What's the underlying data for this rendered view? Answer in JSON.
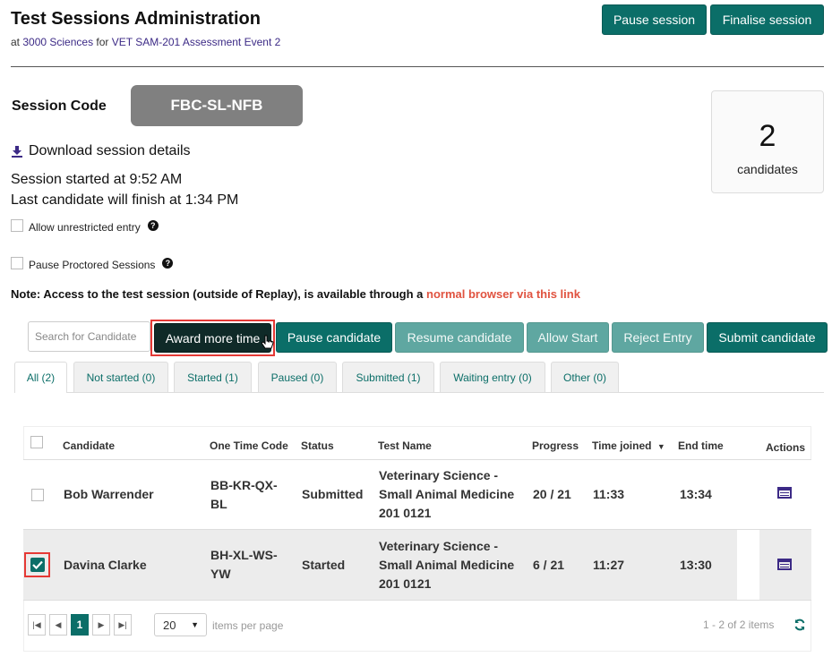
{
  "header": {
    "title": "Test Sessions Administration",
    "sub_prefix": "at ",
    "org_link": "3000 Sciences",
    "sub_for": " for ",
    "event_link": "VET SAM-201 Assessment Event 2",
    "pause_session": "Pause session",
    "finalise_session": "Finalise session"
  },
  "session": {
    "code_label": "Session Code",
    "code": "FBC-SL-NFB",
    "candidate_count": "2",
    "candidate_label": "candidates",
    "download": "Download session details",
    "started": "Session started at 9:52 AM",
    "last_finish": "Last candidate will finish at 1:34 PM",
    "allow_unrestricted": "Allow unrestricted entry",
    "pause_proctored": "Pause Proctored Sessions",
    "note_prefix": "Note: Access to the test session (outside of Replay), is available through a ",
    "note_link": "normal browser via this link"
  },
  "actions": {
    "search_placeholder": "Search for Candidate",
    "award_more_time": "Award more time",
    "pause_candidate": "Pause candidate",
    "resume_candidate": "Resume candidate",
    "allow_start": "Allow Start",
    "reject_entry": "Reject Entry",
    "submit_candidate": "Submit candidate"
  },
  "tabs": [
    {
      "label": "All (2)"
    },
    {
      "label": "Not started (0)"
    },
    {
      "label": "Started (1)"
    },
    {
      "label": "Paused (0)"
    },
    {
      "label": "Submitted (1)"
    },
    {
      "label": "Waiting entry (0)"
    },
    {
      "label": "Other (0)"
    }
  ],
  "table": {
    "columns": {
      "candidate": "Candidate",
      "code": "One Time Code",
      "status": "Status",
      "test": "Test Name",
      "progress": "Progress",
      "joined": "Time joined",
      "end": "End time",
      "actions": "Actions"
    },
    "rows": [
      {
        "name": "Bob Warrender",
        "code1": "BB-KR-QX-",
        "code2": "BL",
        "status": "Submitted",
        "test1": "Veterinary Science -",
        "test2": "Small Animal Medicine",
        "test3": "201 0121",
        "progress": "20 / 21",
        "joined": "11:33",
        "end": "13:34",
        "checked": false
      },
      {
        "name": "Davina Clarke",
        "code1": "BH-XL-WS-",
        "code2": "YW",
        "status": "Started",
        "test1": "Veterinary Science -",
        "test2": "Small Animal Medicine",
        "test3": "201 0121",
        "progress": "6 / 21",
        "joined": "11:27",
        "end": "13:30",
        "checked": true
      }
    ]
  },
  "pager": {
    "current_page": "1",
    "page_size": "20",
    "items_per_page": "items per page",
    "summary": "1 - 2 of 2 items"
  },
  "colors": {
    "primary": "#0b6e68",
    "primary_light": "#5fa7a1",
    "dark": "#0f2a28",
    "link": "#3c2a86",
    "note_link": "#e05340",
    "highlight": "#e53935"
  }
}
